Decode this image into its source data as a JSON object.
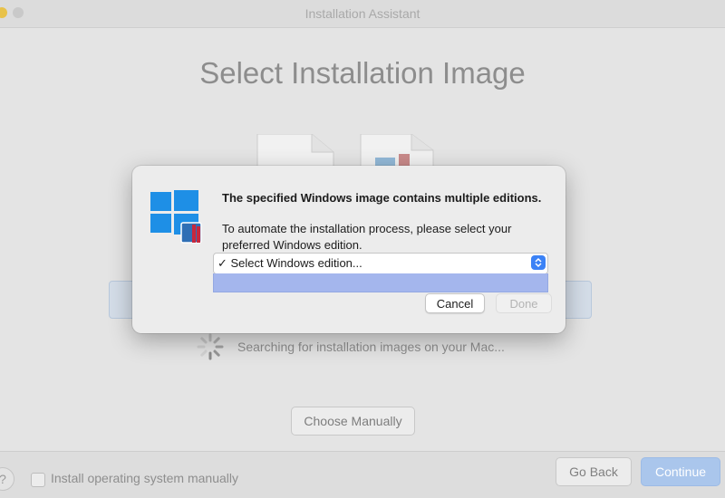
{
  "window": {
    "title": "Installation Assistant",
    "heading": "Select Installation Image"
  },
  "search": {
    "status_text": "Searching for installation images on your Mac..."
  },
  "actions": {
    "choose_manually": "Choose Manually"
  },
  "footer": {
    "help_label": "?",
    "manual_checkbox_label": "Install operating system manually",
    "go_back": "Go Back",
    "continue": "Continue"
  },
  "dialog": {
    "title": "The specified Windows image contains multiple editions.",
    "message": "To automate the installation process, please select your preferred Windows edition.",
    "select_value": "✓ Select Windows edition...",
    "cancel": "Cancel",
    "done": "Done"
  },
  "icons": {
    "windows_logo": "windows-logo-icon",
    "parallels_badge": "parallels-badge-icon",
    "spinner": "loading-spinner-icon",
    "select_arrows": "select-arrows-icon"
  },
  "colors": {
    "windows_blue": "#1e8fe6",
    "accent": "#3b82f6",
    "continue_disabled": "#aac6ec",
    "parallels_red": "#c8283c"
  }
}
